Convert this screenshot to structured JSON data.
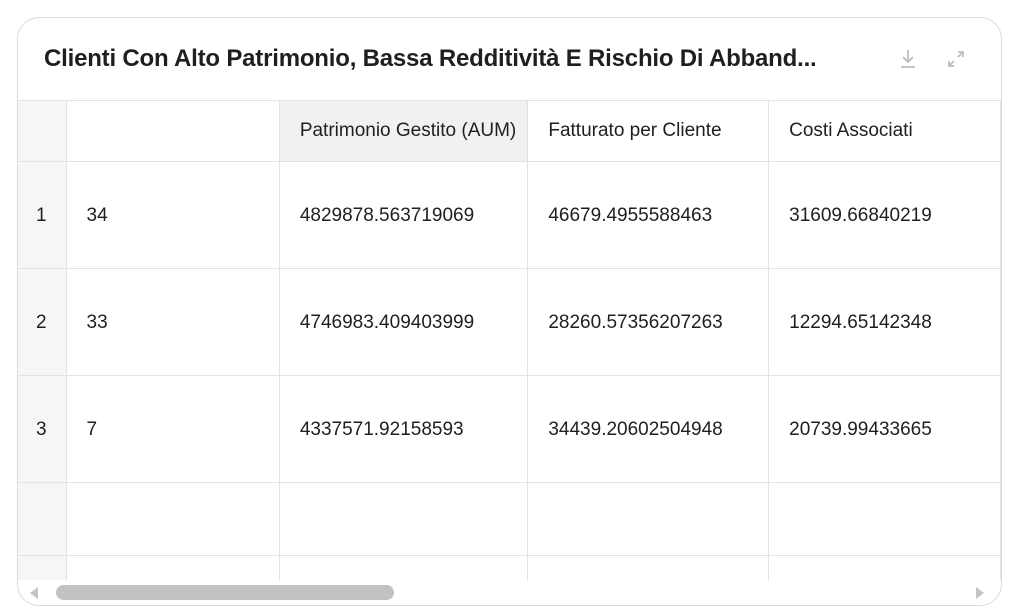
{
  "widget": {
    "title": "Clienti Con Alto Patrimonio, Bassa Redditività E Rischio Di Abband...",
    "download_icon": "download-icon",
    "expand_icon": "expand-icon"
  },
  "table": {
    "columns": [
      "",
      "",
      "Patrimonio Gestito (AUM)",
      "Fatturato per Cliente",
      "Costi Associati"
    ],
    "rows": [
      {
        "index": "1",
        "id": "34",
        "aum": "4829878.563719069",
        "revenue": "46679.4955588463",
        "costs": "31609.66840219"
      },
      {
        "index": "2",
        "id": "33",
        "aum": "4746983.409403999",
        "revenue": "28260.57356207263",
        "costs": "12294.65142348"
      },
      {
        "index": "3",
        "id": "7",
        "aum": "4337571.92158593",
        "revenue": "34439.20602504948",
        "costs": "20739.99433665"
      }
    ]
  },
  "scrollbar": {
    "left_arrow_icon": "arrow-left-icon",
    "right_arrow_icon": "arrow-right-icon"
  }
}
